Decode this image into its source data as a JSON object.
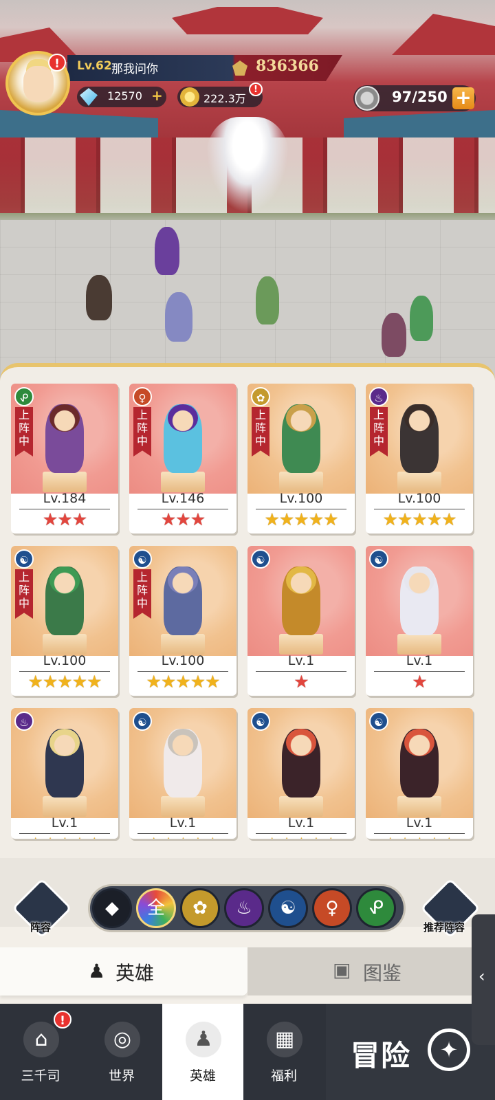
{
  "player": {
    "level": "Lv.62",
    "name": "那我问你",
    "power": "836366",
    "diamonds": "12570",
    "gold": "222.3万",
    "alert_badge": "!"
  },
  "stamina": {
    "value": "97/250",
    "plus": "+"
  },
  "heroes": [
    {
      "level": "Lv.184",
      "stars": "★★★",
      "star_color": "red",
      "bg": "red",
      "deployed": true,
      "faction": "dna-icon"
    },
    {
      "level": "Lv.146",
      "stars": "★★★",
      "star_color": "red",
      "bg": "red",
      "deployed": true,
      "faction": "meditation-icon"
    },
    {
      "level": "Lv.100",
      "stars": "★★★★★",
      "star_color": "gold",
      "bg": "orange",
      "deployed": true,
      "faction": "lotus-icon"
    },
    {
      "level": "Lv.100",
      "stars": "★★★★★",
      "star_color": "gold",
      "bg": "orange",
      "deployed": true,
      "faction": "flame-icon"
    },
    {
      "level": "Lv.100",
      "stars": "★★★★★",
      "star_color": "gold",
      "bg": "orange",
      "deployed": true,
      "faction": "taiji-icon"
    },
    {
      "level": "Lv.100",
      "stars": "★★★★★",
      "star_color": "gold",
      "bg": "orange",
      "deployed": true,
      "faction": "taiji-icon"
    },
    {
      "level": "Lv.1",
      "stars": "★",
      "star_color": "red",
      "bg": "red",
      "deployed": false,
      "faction": "taiji-icon"
    },
    {
      "level": "Lv.1",
      "stars": "★",
      "star_color": "red",
      "bg": "red",
      "deployed": false,
      "faction": "taiji-icon"
    },
    {
      "level": "Lv.1",
      "stars": "★★★★★",
      "star_color": "gold",
      "bg": "orange",
      "deployed": false,
      "faction": "flame-icon"
    },
    {
      "level": "Lv.1",
      "stars": "★★★★★",
      "star_color": "gold",
      "bg": "orange",
      "deployed": false,
      "faction": "taiji-icon"
    },
    {
      "level": "Lv.1",
      "stars": "★★★★★",
      "star_color": "gold",
      "bg": "orange",
      "deployed": false,
      "faction": "taiji-icon"
    },
    {
      "level": "Lv.1",
      "stars": "★★★★★",
      "star_color": "gold",
      "bg": "orange",
      "deployed": false,
      "faction": "taiji-icon"
    }
  ],
  "deployed_label": "上阵中",
  "filter": {
    "lineup_label": "阵容",
    "recommend_label": "推荐阵容",
    "all_label": "全",
    "chips": [
      {
        "name": "strength-filter",
        "glyph": "◆",
        "color": "#1b1f28"
      },
      {
        "name": "all-filter",
        "glyph": "全",
        "color": "#8a4bd6"
      },
      {
        "name": "lotus-filter",
        "glyph": "✿",
        "color": "#c49a2c"
      },
      {
        "name": "flame-filter",
        "glyph": "♨",
        "color": "#5a2a8a"
      },
      {
        "name": "taiji-filter",
        "glyph": "☯",
        "color": "#1f4f8e"
      },
      {
        "name": "meditation-filter",
        "glyph": "♀",
        "color": "#c64a26"
      },
      {
        "name": "dna-filter",
        "glyph": "ᕵ",
        "color": "#2e8a3c"
      }
    ]
  },
  "tabs": {
    "heroes": "英雄",
    "codex": "图鉴"
  },
  "nav": {
    "items": [
      "三千司",
      "世界",
      "英雄",
      "福利"
    ],
    "active_index": 2,
    "adventure": "冒险"
  },
  "colors": {
    "accent_gold": "#f0b21c",
    "deployed_red": "#b5262f",
    "nav_dark": "#2e323a"
  }
}
